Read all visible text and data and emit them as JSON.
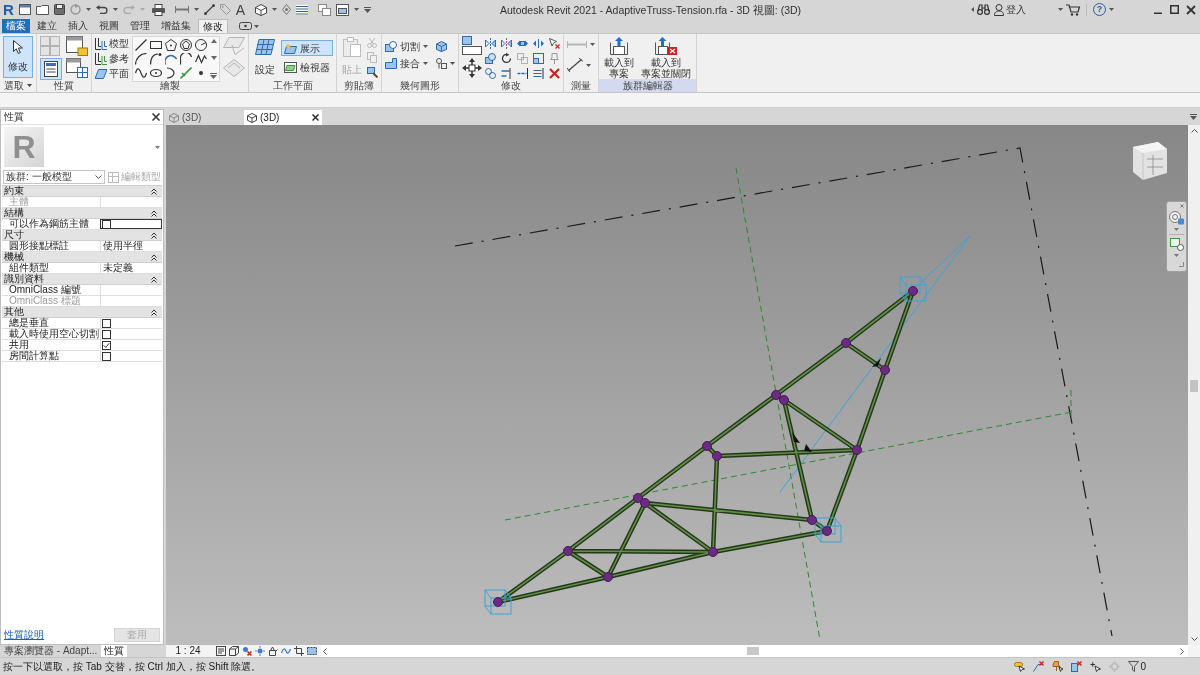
{
  "window": {
    "title": "Autodesk Revit 2021 - AdaptiveTruss-Tension.rfa - 3D 視圖: (3D)"
  },
  "quick_access": {
    "app_button": "R",
    "text_tool": "A"
  },
  "infocenter": {
    "sign_in": "登入",
    "help": "?"
  },
  "ribbon_tabs": [
    {
      "label": "檔案",
      "kind": "file",
      "selected": false
    },
    {
      "label": "建立",
      "kind": "tab",
      "selected": false
    },
    {
      "label": "插入",
      "kind": "tab",
      "selected": false
    },
    {
      "label": "視圖",
      "kind": "tab",
      "selected": false
    },
    {
      "label": "管理",
      "kind": "tab",
      "selected": false
    },
    {
      "label": "增益集",
      "kind": "tab",
      "selected": false
    },
    {
      "label": "修改",
      "kind": "tab",
      "selected": true
    }
  ],
  "ribbon_panels": [
    {
      "kind": "select",
      "title": "選取",
      "tools": [
        {
          "label": "修改",
          "selected": true
        }
      ]
    },
    {
      "kind": "properties",
      "title": "性質",
      "palette_shown": true
    },
    {
      "kind": "draw",
      "title": "繪製",
      "tools": [
        {
          "label": "模型"
        },
        {
          "label": "參考"
        },
        {
          "label": "平面"
        }
      ]
    },
    {
      "kind": "work_plane",
      "title": "工作平面",
      "tools": [
        {
          "label": "設定",
          "selected": false
        },
        {
          "label": "展示",
          "selected": true
        },
        {
          "label": "檢視器",
          "selected": false
        }
      ]
    },
    {
      "kind": "clipboard",
      "title": "剪貼簿",
      "tools": [
        {
          "label": "貼上",
          "disabled": true
        }
      ]
    },
    {
      "kind": "geometry",
      "title": "幾何圖形",
      "tools": [
        {
          "label": "切割"
        },
        {
          "label": "接合"
        }
      ]
    },
    {
      "kind": "modify",
      "title": "修改"
    },
    {
      "kind": "measure",
      "title": "測量"
    },
    {
      "kind": "family_editor",
      "title": "族群編輯器",
      "tools": [
        {
          "lines": [
            "載入到",
            "專案"
          ]
        },
        {
          "lines": [
            "載入到",
            "專案並關閉"
          ]
        }
      ]
    }
  ],
  "properties_palette": {
    "title": "性質",
    "type_preview": "R",
    "type_selector": "族群: 一般模型",
    "edit_type": {
      "label": "編輯類型",
      "disabled": true
    },
    "groups": [
      {
        "title": "約束",
        "expanded": true,
        "rows": [
          {
            "label": "主體",
            "kind": "text",
            "disabled": true,
            "selected": false
          }
        ]
      },
      {
        "title": "結構",
        "expanded": true,
        "rows": [
          {
            "label": "可以作為鋼筋主體",
            "kind": "checkbox",
            "checked": false,
            "disabled": false,
            "selected": true
          }
        ]
      },
      {
        "title": "尺寸",
        "expanded": true,
        "rows": [
          {
            "label": "圓形接點標註",
            "kind": "text",
            "value": "使用半徑",
            "disabled": false,
            "selected": false
          }
        ]
      },
      {
        "title": "機械",
        "expanded": true,
        "rows": [
          {
            "label": "組件類型",
            "kind": "text",
            "value": "未定義",
            "disabled": false,
            "selected": false
          }
        ]
      },
      {
        "title": "識別資料",
        "expanded": true,
        "rows": [
          {
            "label": "OmniClass 編號",
            "kind": "text",
            "disabled": false,
            "selected": false
          },
          {
            "label": "OmniClass 標題",
            "kind": "text",
            "disabled": true,
            "selected": false
          }
        ]
      },
      {
        "title": "其他",
        "expanded": true,
        "rows": [
          {
            "label": "總是垂直",
            "kind": "checkbox",
            "checked": false,
            "disabled": false,
            "selected": false
          },
          {
            "label": "載入時使用空心切割",
            "kind": "checkbox",
            "checked": false,
            "disabled": false,
            "selected": false
          },
          {
            "label": "共用",
            "kind": "checkbox",
            "checked": true,
            "disabled": false,
            "selected": false
          },
          {
            "label": "房間計算點",
            "kind": "checkbox",
            "checked": false,
            "disabled": false,
            "selected": false
          }
        ]
      }
    ],
    "help_link": "性質說明",
    "apply": {
      "label": "套用",
      "disabled": true
    }
  },
  "bottom_tabs": [
    {
      "label": "專案瀏覽器 - Adapt...",
      "selected": false
    },
    {
      "label": "性質",
      "selected": true
    }
  ],
  "view_tabs": [
    {
      "label": "(3D)",
      "selected": false
    },
    {
      "label": "(3D)",
      "selected": true
    }
  ],
  "view_control_bar": {
    "scale": "1 : 24"
  },
  "status_bar": {
    "message": "按一下以選取，按 Tab 交替，按 Ctrl 加入，按 Shift 除選。",
    "filter_count": "0"
  }
}
